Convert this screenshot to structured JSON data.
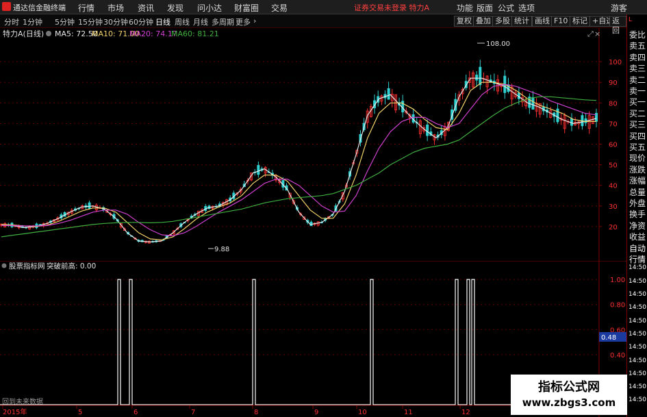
{
  "app": {
    "title": "通达信金融终端",
    "alert": "证券交易未登录 特力A",
    "guest": "游客"
  },
  "menu": [
    "行情",
    "市场",
    "资讯",
    "发现",
    "问小达",
    "财富圈",
    "交易"
  ],
  "menu_right": [
    "功能",
    "版面",
    "公式",
    "选项"
  ],
  "timeframes": [
    "分时",
    "1分钟",
    "5分钟",
    "15分钟",
    "30分钟",
    "60分钟",
    "日线",
    "周线",
    "月线",
    "多周期",
    "更多"
  ],
  "active_timeframe": "日线",
  "toolbar_right": [
    "复权",
    "叠加",
    "多股",
    "统计",
    "画线",
    "F10",
    "标记",
    "+自选",
    "返回"
  ],
  "legend": {
    "stock": "特力A(日线)",
    "ma5": "MA5: 72.50",
    "ma10": "MA10: 71.00",
    "ma20": "MA20: 74.17",
    "ma60": "MA60: 81.21"
  },
  "indicator": {
    "name": "股票指标网",
    "value": "突破前高: 0.00",
    "bottom_label": "回到未来数据",
    "current": "0.48"
  },
  "sidebar": [
    "委比",
    "卖五",
    "卖四",
    "卖三",
    "卖二",
    "卖一",
    "买一",
    "买二",
    "买三",
    "买四",
    "买五",
    "现价",
    "涨跌",
    "涨幅",
    "总量",
    "外盘",
    "换手",
    "净资",
    "收益",
    "自动",
    "行情",
    "14:50",
    "14:50",
    "14:50",
    "14:50",
    "14:50",
    "14:50",
    "14:50",
    "14:50",
    "14:50",
    "14:50",
    "14:50"
  ],
  "sidebar_top": "L",
  "watermark": {
    "title": "指标公式网",
    "url": "www.zbgs3.com"
  },
  "chart_data": {
    "type": "line",
    "title": "特力A(日线)",
    "annotations": [
      {
        "text": "108.00",
        "kind": "high"
      },
      {
        "text": "9.88",
        "kind": "low"
      }
    ],
    "y_ticks": [
      100,
      90,
      80,
      70,
      60,
      50,
      40,
      30,
      20
    ],
    "ylim": [
      5,
      113
    ],
    "x_ticks": [
      "2015年",
      "5",
      "6",
      "7",
      "8",
      "9",
      "10",
      "11",
      "12"
    ],
    "series": [
      {
        "name": "MA5",
        "color": "#e8e8e8",
        "values": [
          21,
          20.5,
          19.5,
          20,
          21.5,
          24,
          27,
          29.5,
          30,
          28.5,
          24,
          17,
          13,
          12.5,
          13,
          17,
          22,
          26,
          29,
          30,
          33,
          38,
          46,
          48,
          44,
          38,
          27,
          21,
          22,
          26,
          37,
          55,
          74,
          82,
          84,
          78,
          72,
          67,
          63,
          68,
          83,
          92,
          92,
          90,
          88,
          84,
          80,
          78,
          75,
          72,
          70,
          71,
          72.5
        ]
      },
      {
        "name": "MA10",
        "color": "#f2d36b",
        "values": [
          21,
          20.8,
          20.3,
          20,
          20.7,
          22.5,
          25,
          27.5,
          29,
          29,
          27,
          22,
          17,
          14,
          13.5,
          15,
          19,
          23.5,
          27,
          29.5,
          31.5,
          35,
          41,
          45,
          45,
          42,
          35,
          28,
          24,
          24,
          31,
          45,
          63,
          75,
          80,
          80,
          77,
          72,
          68,
          67,
          75,
          86,
          90,
          90,
          89,
          86,
          82,
          79,
          77,
          75,
          72,
          71,
          71
        ]
      },
      {
        "name": "MA20",
        "color": "#d040d0",
        "values": [
          20.5,
          20.5,
          20.3,
          20.3,
          20.5,
          21.5,
          23,
          25,
          27,
          28,
          28,
          26,
          22,
          18.5,
          16,
          15.5,
          17,
          20,
          23.5,
          27,
          30,
          33,
          37,
          41,
          43,
          43,
          40,
          35,
          30,
          27,
          27.5,
          35,
          47,
          58,
          66,
          71,
          73,
          73,
          70,
          68,
          70,
          77,
          84,
          88,
          89,
          88,
          86,
          84,
          81,
          79,
          77,
          75,
          74.2
        ]
      },
      {
        "name": "MA60",
        "color": "#40b040",
        "values": [
          15,
          15.8,
          16.5,
          17.3,
          18,
          18.8,
          19.5,
          20.3,
          21,
          21.5,
          21.8,
          22,
          22,
          21.8,
          22,
          22.5,
          23.5,
          24.5,
          25.5,
          26.5,
          27.5,
          28.5,
          30,
          31.5,
          32.5,
          33.5,
          34,
          34.5,
          35,
          36,
          38,
          40,
          43,
          46,
          50,
          53,
          56,
          58,
          59,
          60,
          62,
          66,
          70,
          74,
          77.5,
          80,
          82,
          83,
          83,
          82.5,
          82,
          81.5,
          81.2
        ]
      }
    ],
    "indicator_series": {
      "name": "突破前高",
      "spike_months": [
        "6",
        "6",
        "8",
        "10",
        "12",
        "12",
        "12"
      ],
      "ylim": [
        0,
        1.05
      ],
      "y_ticks": [
        1.0,
        0.8,
        0.6,
        0.4
      ]
    }
  },
  "colors": {
    "up": "#ff3030",
    "down": "#30d0d0",
    "grid": "#600000",
    "axis_text": "#ff3030",
    "accent": "#d22"
  }
}
